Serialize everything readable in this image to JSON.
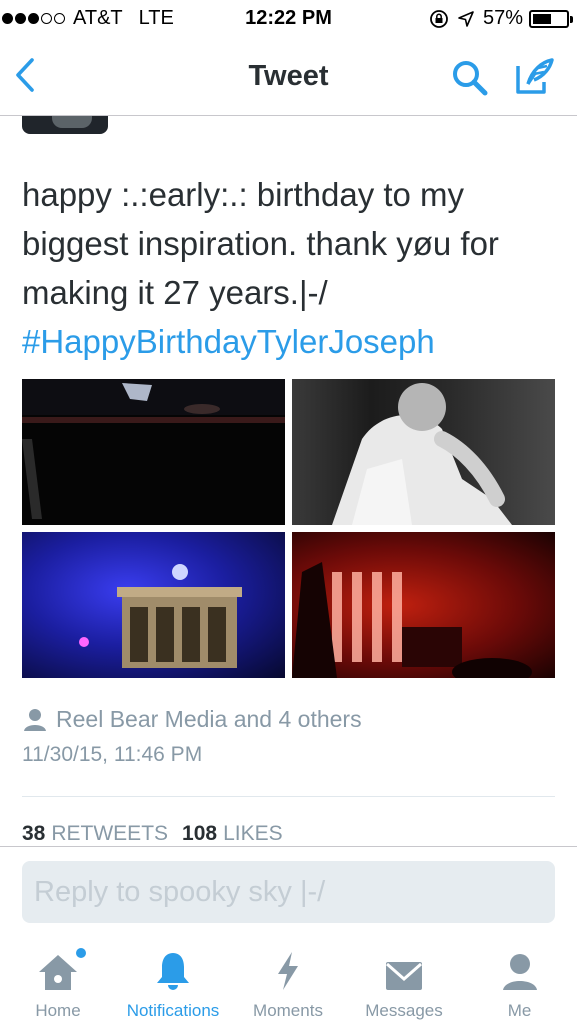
{
  "status_bar": {
    "carrier": "AT&T",
    "network": "LTE",
    "time": "12:22 PM",
    "battery_text": "57%",
    "battery_level": 0.57
  },
  "nav": {
    "title": "Tweet"
  },
  "tweet": {
    "text": "happy :.:early:.: birthday to my biggest inspiration. thank yøu for making it 27 years.|-/",
    "hashtag": "#HappyBirthdayTylerJoseph",
    "retweeted_by": "Reel Bear Media and 4 others",
    "timestamp": "11/30/15, 11:46 PM",
    "retweets_count": "38",
    "retweets_label": "RETWEETS",
    "likes_count": "108",
    "likes_label": "LIKES"
  },
  "reply": {
    "placeholder": "Reply to spooky sky |-/"
  },
  "tabs": [
    {
      "label": "Home",
      "icon": "home-icon"
    },
    {
      "label": "Notifications",
      "icon": "bell-icon"
    },
    {
      "label": "Moments",
      "icon": "lightning-icon"
    },
    {
      "label": "Messages",
      "icon": "envelope-icon"
    },
    {
      "label": "Me",
      "icon": "person-icon"
    }
  ],
  "colors": {
    "accent": "#2b9ce8",
    "text": "#292f33",
    "muted": "#8899a6"
  }
}
